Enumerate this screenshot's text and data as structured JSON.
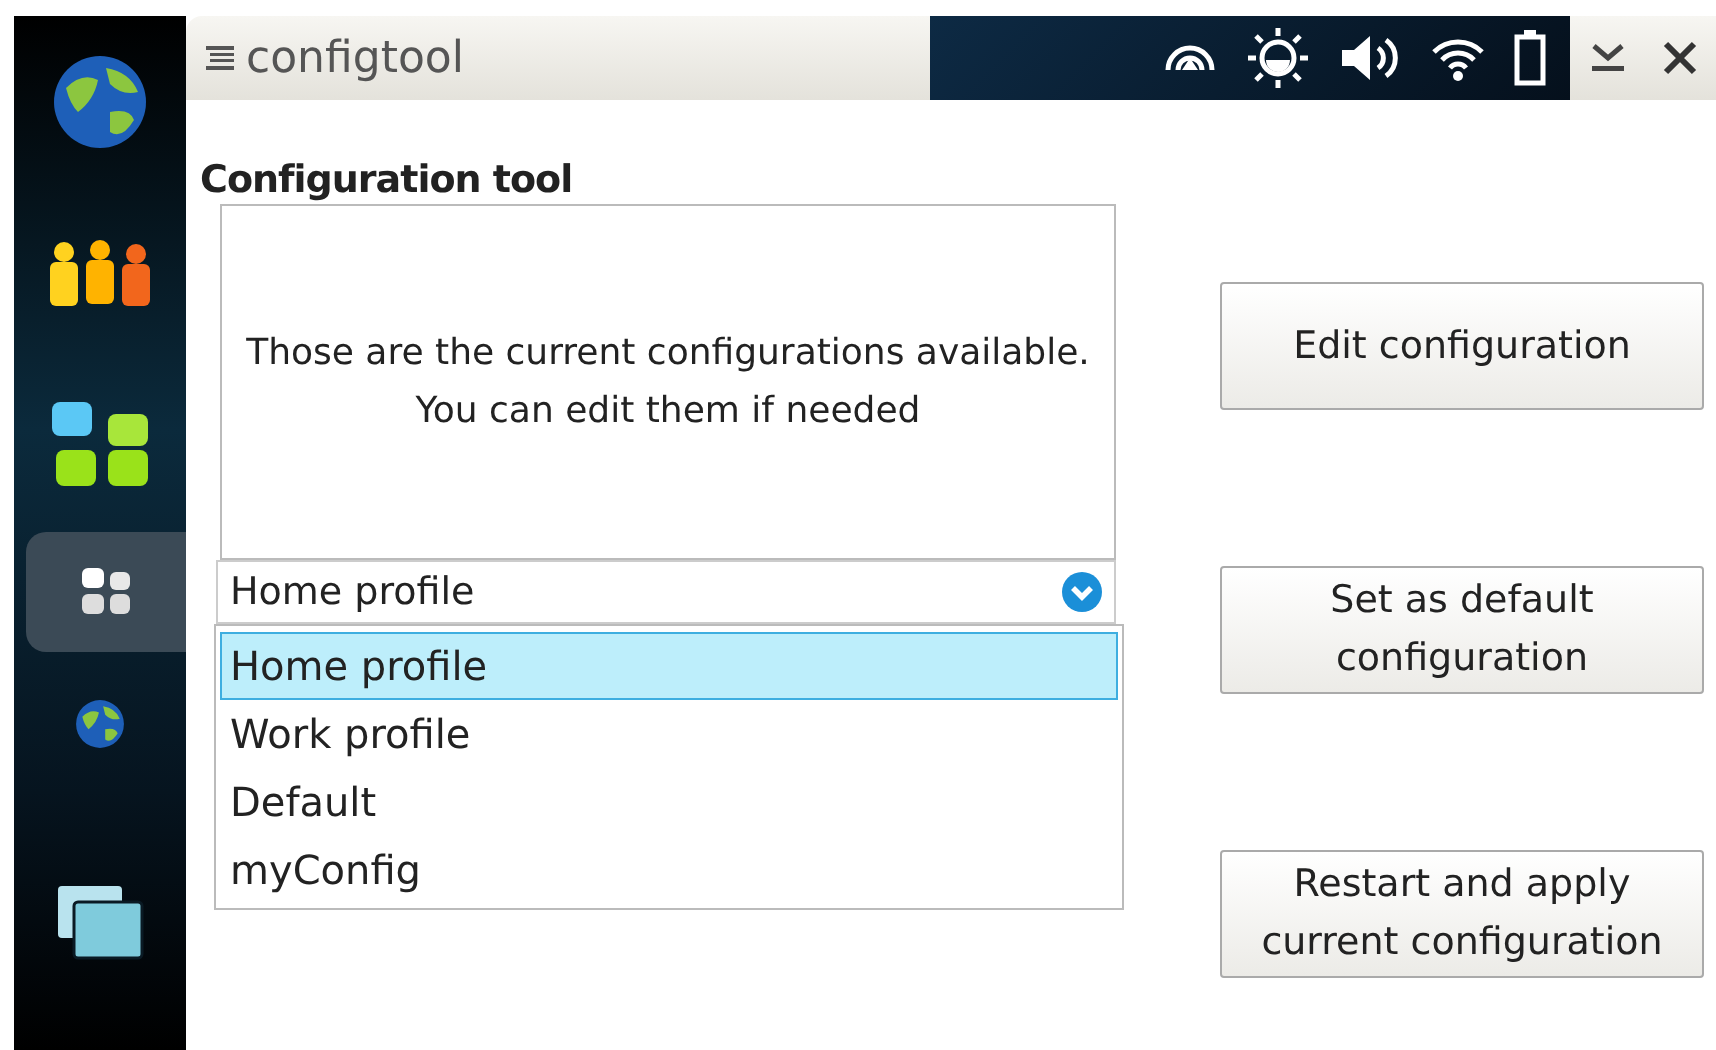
{
  "sidebar": {
    "items": [
      {
        "kind": "globe",
        "selected": false
      },
      {
        "kind": "people",
        "selected": false
      },
      {
        "kind": "apps",
        "selected": false
      },
      {
        "kind": "tiles",
        "selected": true
      },
      {
        "kind": "small-globe",
        "selected": false
      },
      {
        "kind": "windows",
        "selected": false
      }
    ]
  },
  "window": {
    "title": "configtool"
  },
  "heading": "Configuration tool",
  "description": "Those are the current configurations available. You can edit them if needed",
  "combo": {
    "value": "Home profile",
    "expanded": true,
    "options": [
      {
        "label": "Home profile",
        "selected": true
      },
      {
        "label": "Work profile",
        "selected": false
      },
      {
        "label": "Default",
        "selected": false
      },
      {
        "label": "myConfig",
        "selected": false
      }
    ]
  },
  "buttons": [
    "Edit configuration",
    "Set as default configuration",
    "Restart and apply current configuration"
  ]
}
